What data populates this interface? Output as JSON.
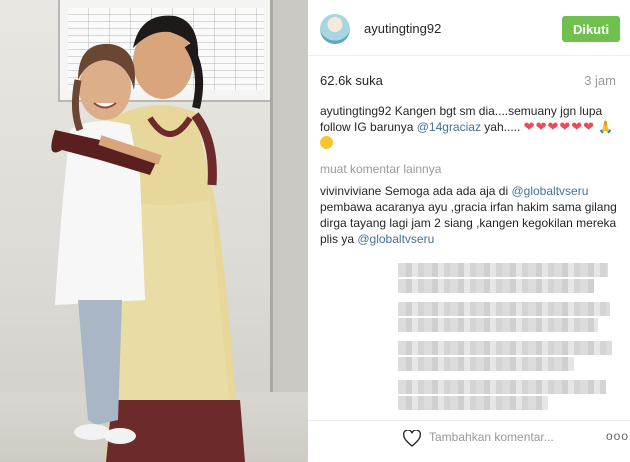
{
  "post": {
    "username": "ayutingting92",
    "follow_label": "Dikuti",
    "likes": "62.6k suka",
    "time": "3 jam"
  },
  "caption": {
    "user": "ayutingting92",
    "text": "Kangen bgt sm dia....semuany jgn lupa follow IG barunya",
    "mention": "@14graciaz",
    "tail": "yah....."
  },
  "load_more": "muat komentar lainnya",
  "comment": {
    "user": "vivinviviane",
    "text1": "Semoga ada ada aja di",
    "mention1": "@globaltvseru",
    "text2": "pembawa acaranya ayu ,gracia irfan hakim sama gilang dirga tayang lagi jam 2 siang ,kangen kegokilan mereka plis ya",
    "mention2": "@globaltvseru"
  },
  "footer": {
    "add_comment_placeholder": "Tambahkan komentar...",
    "more_label": "ooo"
  },
  "colors": {
    "follow_green": "#70c050",
    "link_blue": "#3f729b",
    "heart_red": "#ed4956"
  },
  "icons": {
    "like": "heart-outline-icon",
    "more": "more-options-icon"
  }
}
